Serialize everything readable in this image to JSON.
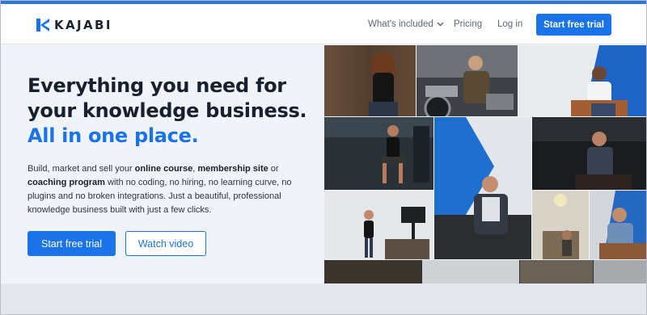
{
  "brand": {
    "name": "KAJABI",
    "accent": "#1a73e8"
  },
  "nav": {
    "whats_included": "What's included",
    "pricing": "Pricing",
    "login": "Log in",
    "cta": "Start free trial"
  },
  "hero": {
    "headline_line1": "Everything you need for",
    "headline_line2": "your knowledge business.",
    "headline_line3": "All in one place.",
    "desc_1": "Build, market and sell your ",
    "desc_b1": "online course",
    "desc_2": ", ",
    "desc_b2": "membership site",
    "desc_3": " or ",
    "desc_b3": "coaching program",
    "desc_4": " with no coding, no hiring, no learning curve, no plugins and no broken integrations. Just a beautiful, professional knowledge business built with just a few clicks.",
    "primary_button": "Start free trial",
    "secondary_button": "Watch video"
  },
  "icons": [
    "kajabi-logo-icon",
    "chevron-down-icon"
  ]
}
